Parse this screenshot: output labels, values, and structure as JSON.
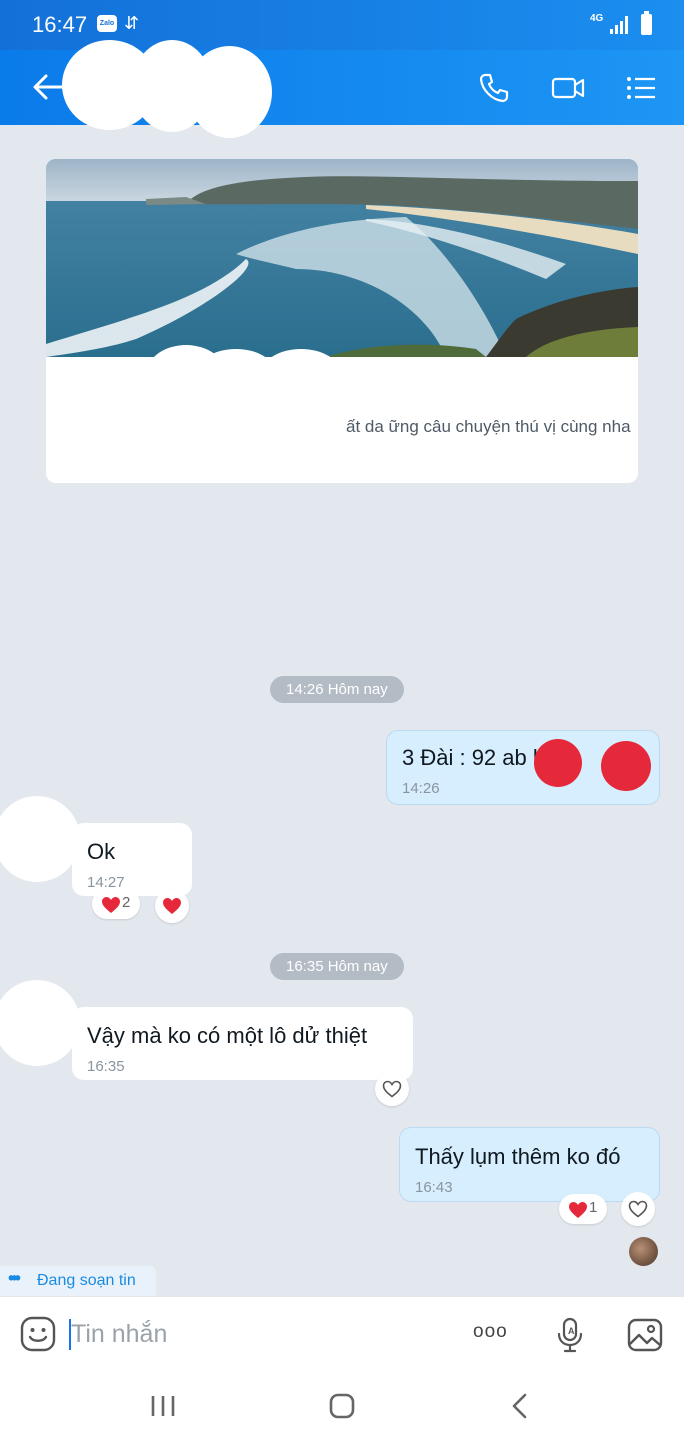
{
  "status_bar": {
    "time": "16:47",
    "network": "4G",
    "zalo_badge": "Zalo"
  },
  "header": {
    "back_icon": "back-arrow-icon",
    "actions": [
      "phone-icon",
      "video-call-icon",
      "menu-list-icon"
    ]
  },
  "link_card": {
    "description": "ất da                          ững câu chuyện thú vị cùng nhau"
  },
  "conversation": {
    "time_separators": [
      "14:26 Hôm nay",
      "16:35 Hôm nay"
    ],
    "messages": [
      {
        "direction": "out",
        "text": "3 Đài : 92 ab      lô",
        "time": "14:26"
      },
      {
        "direction": "in",
        "text": "Ok",
        "time": "14:27",
        "reaction_count": "2"
      },
      {
        "direction": "in",
        "text": "Vậy mà ko có một lô dử thiệt",
        "time": "16:35"
      },
      {
        "direction": "out",
        "text": "Thấy lụm thêm ko đó",
        "time": "16:43",
        "reaction_count": "1"
      }
    ]
  },
  "typing_indicator": {
    "dots": "•••",
    "text": "Đang soạn tin"
  },
  "composer": {
    "placeholder": "Tin nhắn",
    "more_label": "ooo"
  },
  "colors": {
    "header": "#1a8cf0",
    "out_bubble": "#d6eefd",
    "background": "#e3e8ee",
    "accent": "#1a8be0",
    "heart": "#e5293a"
  }
}
